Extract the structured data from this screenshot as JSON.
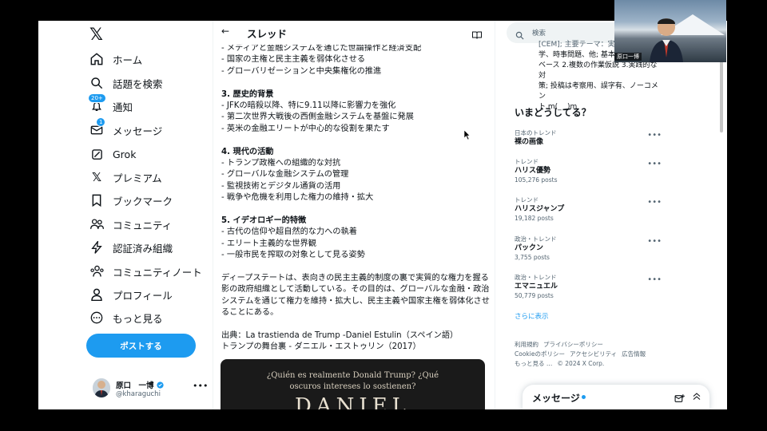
{
  "nav": {
    "items": [
      {
        "label": "ホーム",
        "icon": "home-icon"
      },
      {
        "label": "話題を検索",
        "icon": "search-icon"
      },
      {
        "label": "通知",
        "icon": "bell-icon",
        "badge": "20+"
      },
      {
        "label": "メッセージ",
        "icon": "mail-icon",
        "badge": "1"
      },
      {
        "label": "Grok",
        "icon": "grok-icon"
      },
      {
        "label": "プレミアム",
        "icon": "x-icon"
      },
      {
        "label": "ブックマーク",
        "icon": "bookmark-icon"
      },
      {
        "label": "コミュニティ",
        "icon": "community-icon"
      },
      {
        "label": "認証済み組織",
        "icon": "lightning-icon"
      },
      {
        "label": "コミュニティノート",
        "icon": "notes-icon"
      },
      {
        "label": "プロフィール",
        "icon": "person-icon"
      },
      {
        "label": "もっと見る",
        "icon": "more-circle-icon"
      }
    ],
    "post_button": "ポストする",
    "profile": {
      "name": "原口　一博",
      "handle": "@kharaguchi"
    }
  },
  "thread": {
    "title": "スレッド",
    "lines_top": [
      "- メディアと金融システムを通じた世論操作と経済支配",
      "- 国家の主権と民主主義を弱体化させる",
      "- グローバリゼーションと中央集権化の推進"
    ],
    "section3_title": "3. 歴史的背景",
    "section3": [
      "- JFKの暗殺以降、特に9.11以降に影響力を強化",
      "- 第二次世界大戦後の西側金融システムを基盤に発展",
      "- 英米の金融エリートが中心的な役割を果たす"
    ],
    "section4_title": "4. 現代の活動",
    "section4": [
      "- トランプ政権への組織的な対抗",
      "- グローバルな金融システムの管理",
      "- 監視技術とデジタル通貨の活用",
      "- 戦争や危機を利用した権力の維持・拡大"
    ],
    "section5_title": "5. イデオロギー的特徴",
    "section5": [
      "- 古代の信仰や超自然的な力への執着",
      "- エリート主義的な世界観",
      "- 一般市民を搾取の対象として見る姿勢"
    ],
    "summary": "ディープステートは、表向きの民主主義的制度の裏で実質的な権力を握る影の政府組織として活動している。その目的は、グローバルな金融・政治システムを通じて権力を維持・拡大し、民主主義や国家主権を弱体化させることにある。",
    "source1": "出典：La trastienda de Trump -Daniel Estulin（スペイン語）",
    "source2": "トランプの舞台裏 - ダニエル・エストゥリン（2017）",
    "image_caption": "¿Quién es realmente Donald Trump? ¿Qué oscuros intereses lo sostienen?",
    "image_big": "DANIEL"
  },
  "right": {
    "search_placeholder": "検索",
    "announcement_lines": [
      "[CEM]; 主要テーマ：実験数",
      "学、時事問題、他; 基本方",
      "ベース 2.複数の作業仮説 3.実践的な対",
      "策; 投稿は考察用、誤字有、ノーコメン",
      "ト m(_ _)m"
    ],
    "trends_title": "いまどうしてる？",
    "trends": [
      {
        "category": "日本のトレンド",
        "name": "裸の画像",
        "count": ""
      },
      {
        "category": "トレンド",
        "name": "ハリス優勢",
        "count": "105,276 posts"
      },
      {
        "category": "トレンド",
        "name": "ハリスジャンプ",
        "count": "19,182 posts"
      },
      {
        "category": "政治・トレンド",
        "name": "パックン",
        "count": "3,755 posts"
      },
      {
        "category": "政治・トレンド",
        "name": "エマニュエル",
        "count": "50,779 posts"
      }
    ],
    "show_more": "さらに表示",
    "footer": [
      "利用規約",
      "プライバシーポリシー",
      "Cookieのポリシー",
      "アクセシビリティ",
      "広告情報",
      "もっと見る …",
      "© 2024 X Corp."
    ],
    "messages_title": "メッセージ"
  },
  "webcam": {
    "label": "原口一博"
  },
  "colors": {
    "accent": "#1d9bf0",
    "text": "#0f1419",
    "muted": "#536471"
  }
}
